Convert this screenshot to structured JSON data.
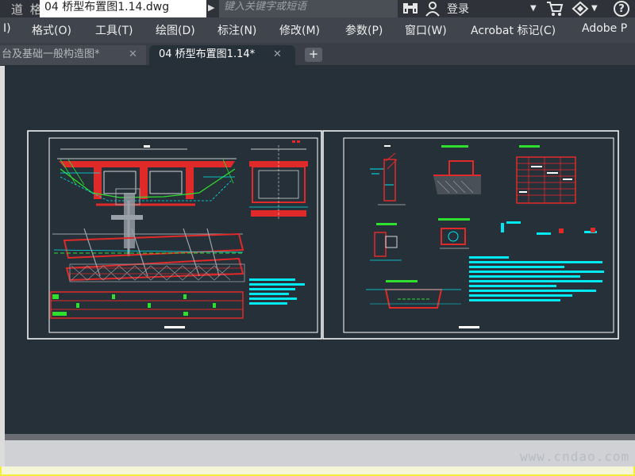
{
  "titlebar": {
    "logo": "道 格 网",
    "document_title": "04 桥型布置图1.14.dwg",
    "search_placeholder": "键入关键字或短语",
    "login_label": "登录",
    "help_label": "?"
  },
  "menu": {
    "items": [
      {
        "label": "I)"
      },
      {
        "label": "格式(O)"
      },
      {
        "label": "工具(T)"
      },
      {
        "label": "绘图(D)"
      },
      {
        "label": "标注(N)"
      },
      {
        "label": "修改(M)"
      },
      {
        "label": "参数(P)"
      },
      {
        "label": "窗口(W)"
      },
      {
        "label": "Acrobat 标记(C)"
      },
      {
        "label": "Adobe P"
      }
    ]
  },
  "tabs": {
    "inactive_label": "台及基础一般构造图*",
    "active_label": "04 桥型布置图1.14*",
    "close_glyph": "✕",
    "add_glyph": "+"
  },
  "drawing": {
    "background": "#263038",
    "colors": {
      "red": "#e02a2a",
      "cyan": "#00e8f0",
      "green": "#2fe02f",
      "white": "#ffffff",
      "gray": "#9aa0a8",
      "yellow": "#f2ee3a"
    }
  },
  "watermark": "www.cndao.com"
}
